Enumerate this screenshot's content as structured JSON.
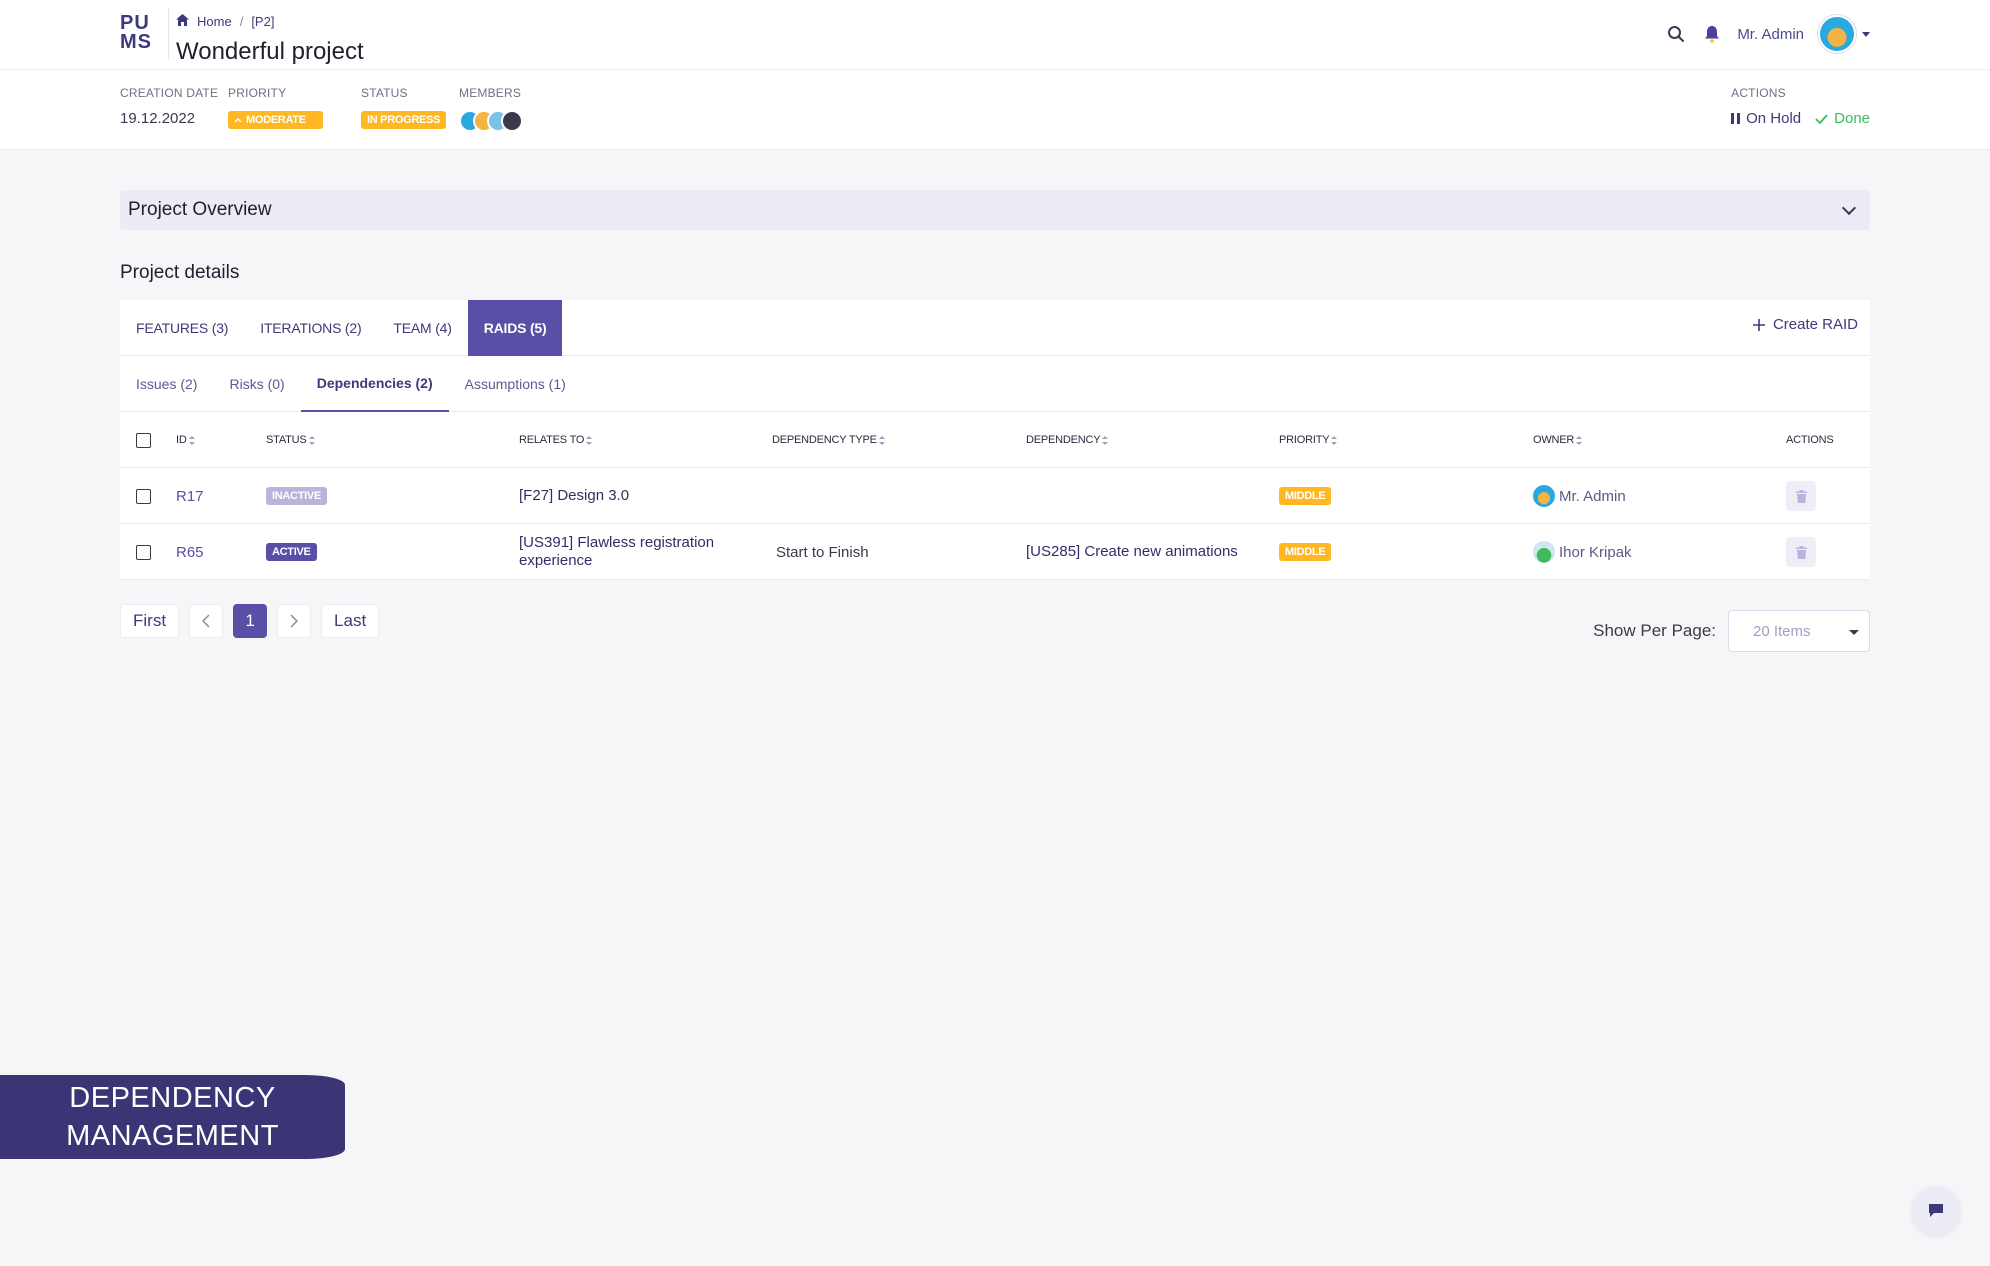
{
  "app": {
    "logo_text": "PUMS"
  },
  "breadcrumb": {
    "home": "Home",
    "separator": "/",
    "current": "[P2]"
  },
  "page": {
    "title": "Wonderful project"
  },
  "user": {
    "name": "Mr. Admin"
  },
  "meta": {
    "creation_date_label": "CREATION DATE",
    "creation_date": "19.12.2022",
    "priority_label": "PRIORITY",
    "priority": "MODERATE",
    "status_label": "STATUS",
    "status": "IN PROGRESS",
    "members_label": "MEMBERS",
    "actions_label": "ACTIONS",
    "on_hold": "On Hold",
    "done": "Done"
  },
  "overview": {
    "title": "Project Overview"
  },
  "details": {
    "title": "Project details"
  },
  "tabs": [
    {
      "label": "FEATURES (3)",
      "active": false
    },
    {
      "label": "ITERATIONS (2)",
      "active": false
    },
    {
      "label": "TEAM (4)",
      "active": false
    },
    {
      "label": "RAIDS (5)",
      "active": true
    }
  ],
  "create_raid": "Create RAID",
  "subtabs": [
    {
      "label": "Issues (2)",
      "active": false
    },
    {
      "label": "Risks (0)",
      "active": false
    },
    {
      "label": "Dependencies (2)",
      "active": true
    },
    {
      "label": "Assumptions (1)",
      "active": false
    }
  ],
  "table": {
    "headers": {
      "id": "ID",
      "status": "STATUS",
      "relates_to": "RELATES TO",
      "dependency_type": "DEPENDENCY TYPE",
      "dependency": "DEPENDENCY",
      "priority": "PRIORITY",
      "owner": "OWNER",
      "actions": "ACTIONS"
    },
    "rows": [
      {
        "id": "R17",
        "status": "INACTIVE",
        "relates_to": "[F27] Design 3.0",
        "dependency_type": "",
        "dependency": "",
        "priority": "MIDDLE",
        "owner": "Mr. Admin"
      },
      {
        "id": "R65",
        "status": "ACTIVE",
        "relates_to": "[US391] Flawless registration experience",
        "dependency_type": "Start to Finish",
        "dependency": "[US285] Create new animations",
        "priority": "MIDDLE",
        "owner": "Ihor Kripak"
      }
    ]
  },
  "pagination": {
    "first": "First",
    "page": "1",
    "last": "Last"
  },
  "per_page": {
    "label": "Show Per Page:",
    "value": "20 Items"
  },
  "banner": {
    "line1": "DEPENDENCY",
    "line2": "MANAGEMENT"
  },
  "colors": {
    "primary": "#5a4fa6",
    "amber": "#ffb822",
    "success": "#3dbb5b",
    "banner": "#3c3575"
  }
}
